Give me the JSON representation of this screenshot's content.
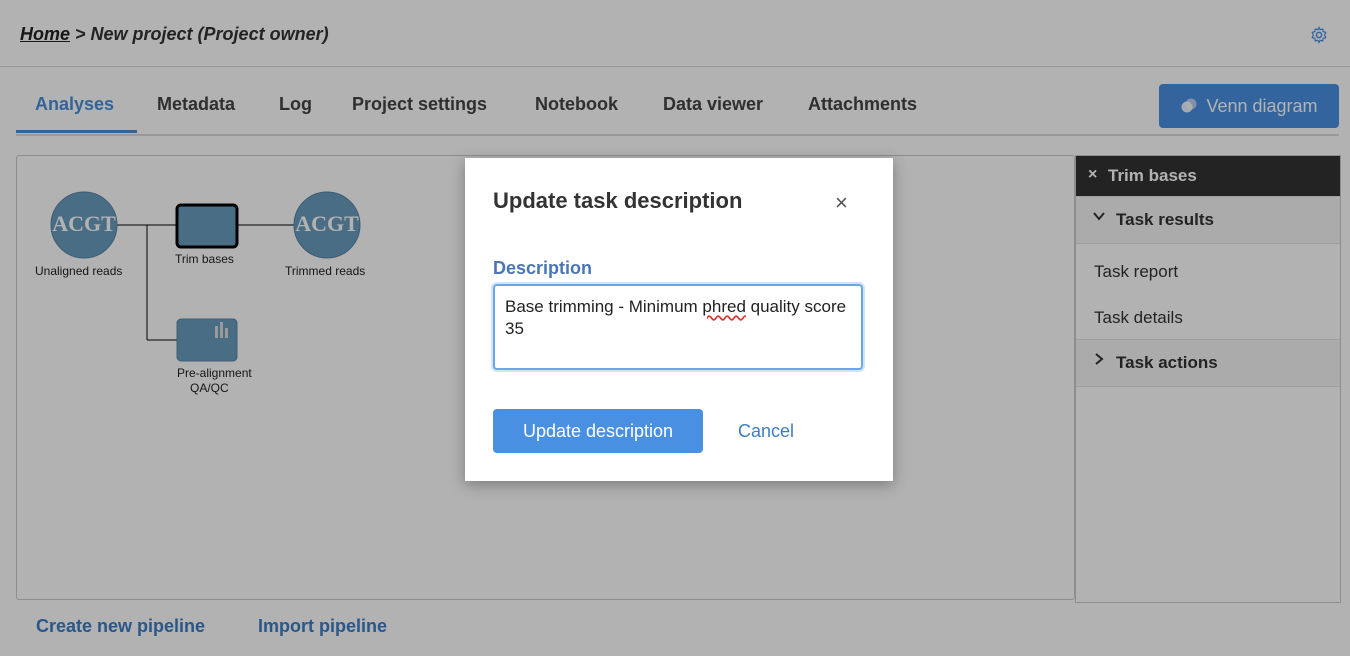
{
  "breadcrumb": {
    "home": "Home",
    "rest": " > New project (Project owner)"
  },
  "tabs": [
    {
      "label": "Analyses"
    },
    {
      "label": "Metadata"
    },
    {
      "label": "Log"
    },
    {
      "label": "Project settings"
    },
    {
      "label": "Notebook"
    },
    {
      "label": "Data viewer"
    },
    {
      "label": "Attachments"
    }
  ],
  "venn_button": "Venn diagram",
  "pipeline": {
    "unaligned": "Unaligned reads",
    "trim": "Trim bases",
    "trimmed": "Trimmed reads",
    "qc_line1": "Pre-alignment",
    "qc_line2": "QA/QC"
  },
  "panel": {
    "title": "Trim bases",
    "close": "×",
    "results": "Task results",
    "report": "Task report",
    "details": "Task details",
    "actions": "Task actions"
  },
  "footer": {
    "create": "Create new pipeline",
    "import": "Import pipeline"
  },
  "modal": {
    "title": "Update task description",
    "close": "×",
    "label": "Description",
    "value_part1": "Base trimming - Minimum ",
    "value_spell": "phred",
    "value_part2": " quality score 35",
    "update": "Update description",
    "cancel": "Cancel"
  },
  "colors": {
    "accent": "#4a90e2",
    "node": "#6a9cc0",
    "panel_head": "#333333"
  }
}
